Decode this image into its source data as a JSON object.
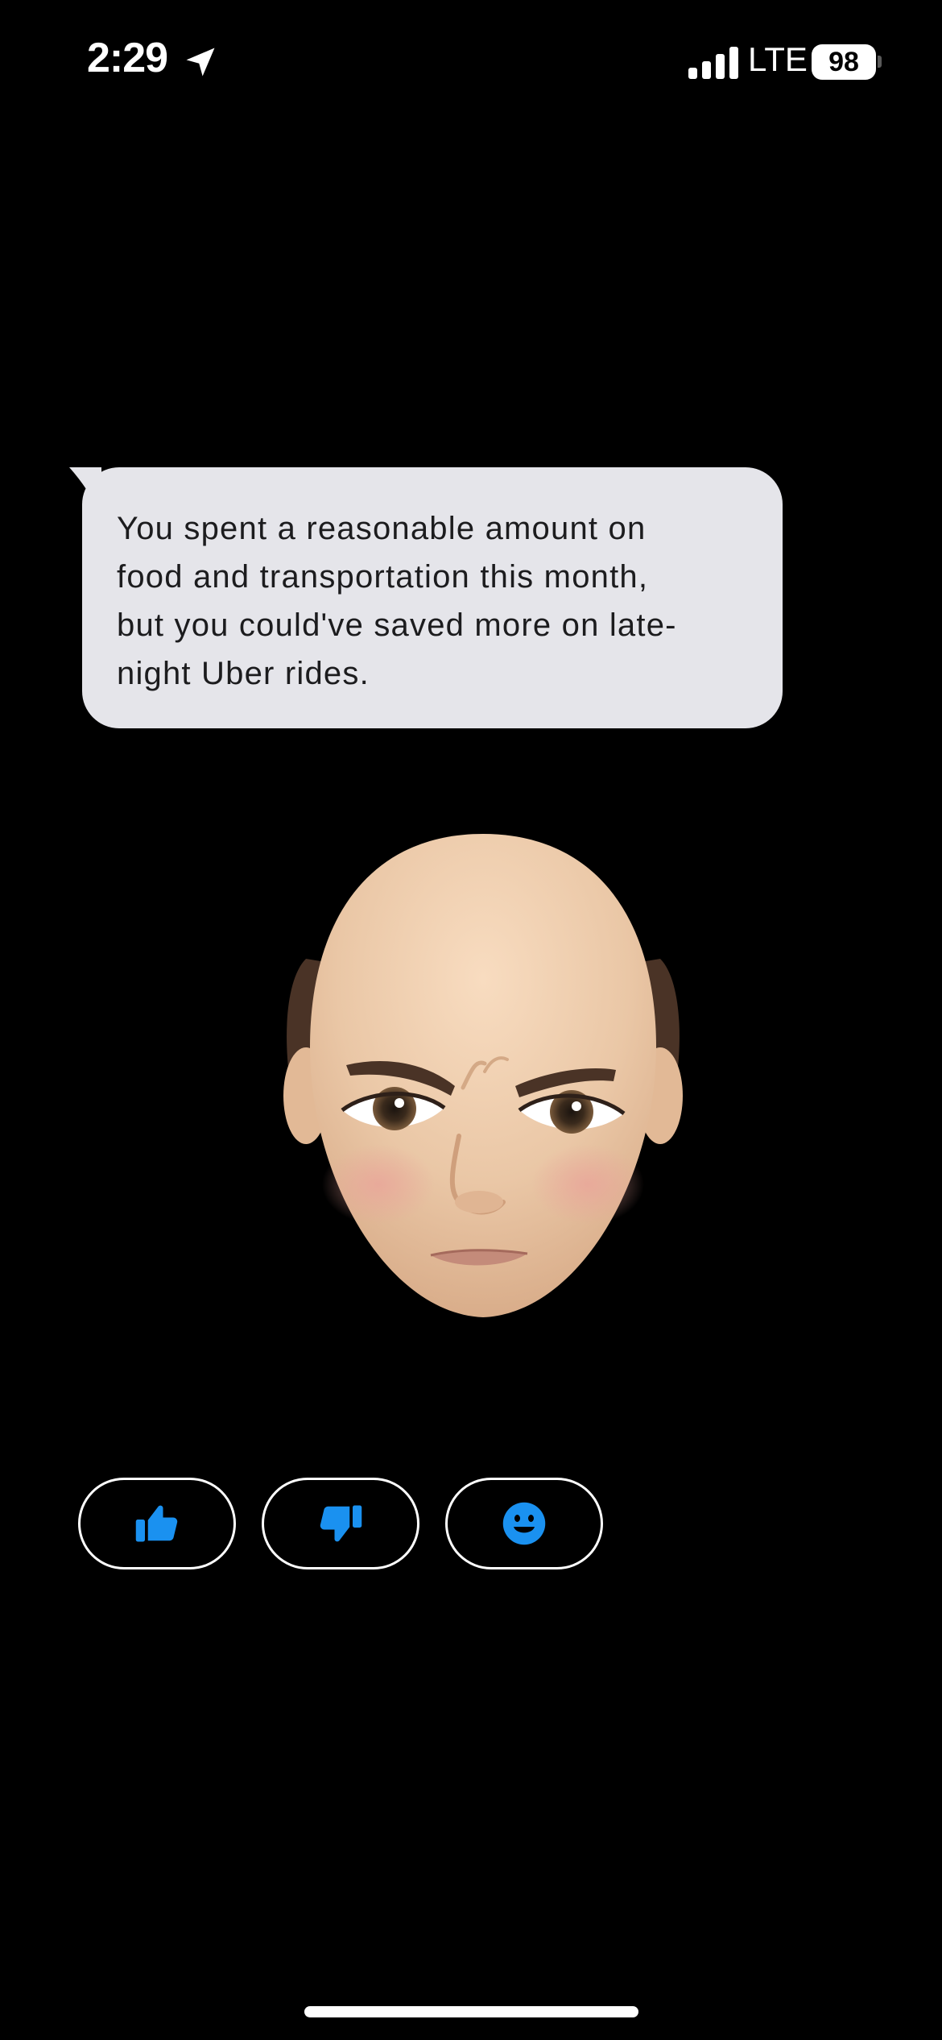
{
  "status_bar": {
    "time": "2:29",
    "network": "LTE",
    "battery": "98",
    "icons": [
      "location-arrow-icon",
      "cellular-signal-icon",
      "battery-icon"
    ]
  },
  "message": {
    "lines": [
      "You spent a reasonable amount on",
      "food and transportation this month,",
      "but you could've saved more on late-",
      "night Uber rides."
    ]
  },
  "avatar": {
    "icon": "memoji-avatar"
  },
  "reactions": [
    {
      "icon": "thumbs-up-icon"
    },
    {
      "icon": "thumbs-down-icon"
    },
    {
      "icon": "smiley-face-icon"
    }
  ],
  "colors": {
    "background": "#000000",
    "bubble": "#e5e5ea",
    "bubble_text": "#1c1c1e",
    "accent_blue": "#1a91f0",
    "button_border": "#ffffff"
  }
}
